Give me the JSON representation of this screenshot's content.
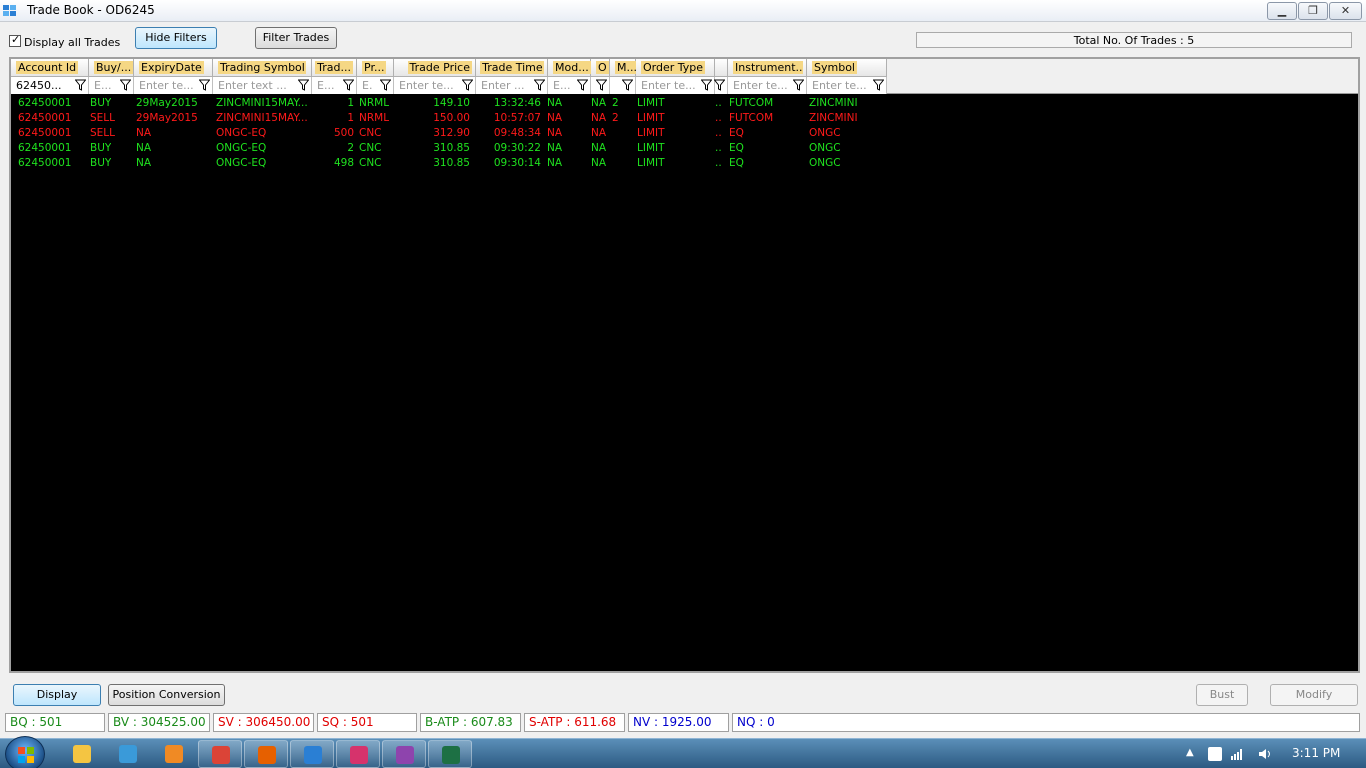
{
  "window": {
    "title": "Trade Book - OD6245",
    "controls": {
      "minimize": "▁",
      "maximize": "❐",
      "close": "✕"
    }
  },
  "toolbar": {
    "display_all_label": "Display all Trades",
    "display_all_checked": true,
    "hide_filters_label": "Hide Filters",
    "filter_trades_label": "Filter Trades",
    "total_trades_label": "Total No. Of Trades : 5",
    "progress_fraction": 0.0
  },
  "grid": {
    "columns": [
      {
        "key": "account",
        "header": "Account Id",
        "filter": "62450...",
        "filter_is_value": true
      },
      {
        "key": "buysell",
        "header": "Buy/...",
        "filter": "E..."
      },
      {
        "key": "expiry",
        "header": "ExpiryDate",
        "filter": "Enter te..."
      },
      {
        "key": "symbol",
        "header": "Trading Symbol",
        "filter": "Enter text ..."
      },
      {
        "key": "qty",
        "header": "Trad...",
        "filter": "E..."
      },
      {
        "key": "product",
        "header": "Pr...",
        "filter": "E."
      },
      {
        "key": "price",
        "header": "Trade Price",
        "filter": "Enter te..."
      },
      {
        "key": "time",
        "header": "Trade Time",
        "filter": "Enter ..."
      },
      {
        "key": "mode",
        "header": "Mod...",
        "filter": "E..."
      },
      {
        "key": "o",
        "header": "O",
        "filter": ""
      },
      {
        "key": "m",
        "header": "M...",
        "filter": ""
      },
      {
        "key": "ordertype",
        "header": "Order Type",
        "filter": "Enter te..."
      },
      {
        "key": "extra",
        "header": "",
        "filter": ""
      },
      {
        "key": "instrument",
        "header": "Instrument...",
        "filter": "Enter te..."
      },
      {
        "key": "sym",
        "header": "Symbol",
        "filter": "Enter te..."
      }
    ],
    "rows": [
      {
        "side": "buy",
        "account": "62450001",
        "buysell": "BUY",
        "expiry": "29May2015",
        "symbol": "ZINCMINI15MAY...",
        "qty": "1",
        "product": "NRML",
        "price": "149.10",
        "time": "13:32:46",
        "mode": "NA",
        "o": "NA",
        "m": "2",
        "ordertype": "LIMIT",
        "extra": "..",
        "instrument": "FUTCOM",
        "sym": "ZINCMINI"
      },
      {
        "side": "sell",
        "account": "62450001",
        "buysell": "SELL",
        "expiry": "29May2015",
        "symbol": "ZINCMINI15MAY...",
        "qty": "1",
        "product": "NRML",
        "price": "150.00",
        "time": "10:57:07",
        "mode": "NA",
        "o": "NA",
        "m": "2",
        "ordertype": "LIMIT",
        "extra": "..",
        "instrument": "FUTCOM",
        "sym": "ZINCMINI"
      },
      {
        "side": "sell",
        "account": "62450001",
        "buysell": "SELL",
        "expiry": "NA",
        "symbol": "ONGC-EQ",
        "qty": "500",
        "product": "CNC",
        "price": "312.90",
        "time": "09:48:34",
        "mode": "NA",
        "o": "NA",
        "m": "",
        "ordertype": "LIMIT",
        "extra": "..",
        "instrument": "EQ",
        "sym": "ONGC"
      },
      {
        "side": "buy",
        "account": "62450001",
        "buysell": "BUY",
        "expiry": "NA",
        "symbol": "ONGC-EQ",
        "qty": "2",
        "product": "CNC",
        "price": "310.85",
        "time": "09:30:22",
        "mode": "NA",
        "o": "NA",
        "m": "",
        "ordertype": "LIMIT",
        "extra": "..",
        "instrument": "EQ",
        "sym": "ONGC"
      },
      {
        "side": "buy",
        "account": "62450001",
        "buysell": "BUY",
        "expiry": "NA",
        "symbol": "ONGC-EQ",
        "qty": "498",
        "product": "CNC",
        "price": "310.85",
        "time": "09:30:14",
        "mode": "NA",
        "o": "NA",
        "m": "",
        "ordertype": "LIMIT",
        "extra": "..",
        "instrument": "EQ",
        "sym": "ONGC"
      }
    ]
  },
  "bottom": {
    "display_label": "Display",
    "position_conversion_label": "Position Conversion",
    "bust_label": "Bust",
    "modify_label": "Modify"
  },
  "status": {
    "bq": "BQ : 501",
    "bv": "BV : 304525.00",
    "sv": "SV : 306450.00",
    "sq": "SQ : 501",
    "batp": "B-ATP : 607.83",
    "satp": "S-ATP : 611.68",
    "nv": "NV : 1925.00",
    "nq": "NQ : 0"
  },
  "taskbar": {
    "clock": "3:11 PM",
    "apps": [
      "explorer-icon",
      "ie-icon",
      "media-player-icon",
      "chrome-icon",
      "firefox-icon",
      "trading-app-icon",
      "app-icon",
      "prism-icon",
      "excel-icon"
    ]
  },
  "colors": {
    "buy": "#1fe21f",
    "sell": "#ff1a1a",
    "grid_bg": "#000000",
    "header_highlight": "#f5d784"
  }
}
